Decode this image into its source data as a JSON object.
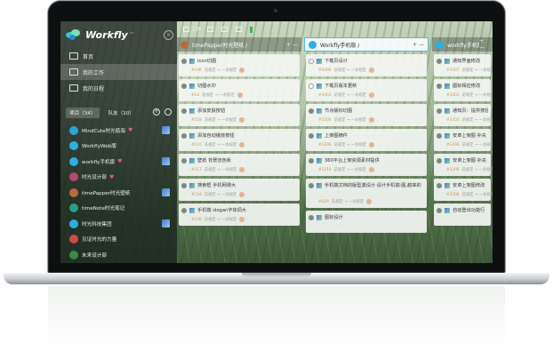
{
  "app": {
    "name": "Workfly",
    "tm": "™"
  },
  "sidebar": {
    "nav": [
      {
        "label": "首页",
        "icon": "home-icon"
      },
      {
        "label": "我的工作",
        "icon": "tasks-icon",
        "active": true
      },
      {
        "label": "我的日程",
        "icon": "calendar-icon"
      }
    ],
    "project_tab": "项目（34）",
    "team_tab": "队友（10）",
    "projects": [
      {
        "name": "MindCute时光瓶海",
        "color": "#26a6d8",
        "heart": "♥",
        "thumb": true
      },
      {
        "name": "WorkflyWeb版",
        "color": "#2ab0e6",
        "heart": "",
        "thumb": false
      },
      {
        "name": "workfly手机版",
        "color": "#2ab0e6",
        "heart": "♥",
        "thumb": true
      },
      {
        "name": "时光设计部",
        "color": "#b04b72",
        "heart": "♥",
        "thumb": false
      },
      {
        "name": "timePapper时光壁纸",
        "color": "#b86a3c",
        "heart": "",
        "thumb": true
      },
      {
        "name": "timeNote时光笔记",
        "color": "#2a9d82",
        "heart": "",
        "thumb": false
      },
      {
        "name": "时光科技集团",
        "color": "#2ab0e6",
        "heart": "",
        "thumb": true
      },
      {
        "name": "见证时光的力量",
        "color": "#d04a4a",
        "heart": "",
        "thumb": false
      },
      {
        "name": "未来设计部",
        "color": "#3a8a4a",
        "heart": "",
        "thumb": false
      }
    ]
  },
  "topbar": [
    {
      "label": "工作",
      "icon": "board-icon"
    },
    {
      "label": "",
      "icon": "list-icon"
    },
    {
      "label": "",
      "icon": "file-icon"
    },
    {
      "label": "",
      "icon": "chart-icon"
    }
  ],
  "columns": [
    {
      "title": "timePapper时光壁纸 /",
      "color": "#b86a3c",
      "highlight": false,
      "cards": [
        {
          "title": "icon切图",
          "id": "#146",
          "meta": "迭规定 → 一龙规定"
        },
        {
          "title": "切图水印",
          "id": "#14",
          "meta": "迭规定 → 一龙规定"
        },
        {
          "title": "添加皮肤按钮",
          "id": "#118",
          "meta": "迭规定 → 一龙规定"
        },
        {
          "title": "添加自动播放按钮",
          "id": "#116",
          "meta": "迭规定 → 一龙规定"
        },
        {
          "title": "壁纸 背景流色板",
          "id": "#117",
          "meta": "迭规定 → 一龙规定"
        },
        {
          "title": "搜索框 手机网课大",
          "id": "#134",
          "meta": "迭规定 → 一龙规定"
        },
        {
          "title": "手机端 slogan字体调大",
          "id": "#136",
          "meta": "迭规定 → 一龙规定"
        }
      ]
    },
    {
      "title": "Workfly手机版 /",
      "color": "#2ab0e6",
      "highlight": true,
      "cards": [
        {
          "title": "下载页设计",
          "id": "#3494",
          "meta": "迭规定 → 一龙规定",
          "open": true
        },
        {
          "title": "下载页版本更新",
          "id": "#3463",
          "meta": "迭规定 → 一龙规定",
          "open": true
        },
        {
          "title": "节点版标切图",
          "id": "#3506",
          "meta": "迭规定 → 一龙规定"
        },
        {
          "title": "上架图摘件",
          "id": "#3308",
          "meta": "迭规定 → 一龙规定"
        },
        {
          "title": "360平台上架资源素材提供",
          "id": "#3310",
          "meta": "迭规定 → 一龙规定"
        },
        {
          "title": "手机端文档的版型激设计·设计手机端·图,越来的",
          "id": "#429",
          "meta": "迭规定 → 一龙规定",
          "tall": true
        },
        {
          "title": "图标设计",
          "id": "",
          "meta": ""
        }
      ]
    },
    {
      "title": "workfly手机版 /",
      "color": "#2ab0e6",
      "highlight": false,
      "cards": [
        {
          "title": "通知界面修改",
          "id": "#3307",
          "meta": "迭规定 → 一龙规定"
        },
        {
          "title": "图标相应修改",
          "id": "#3303",
          "meta": "迭规定 → 一龙规定"
        },
        {
          "title": "通知页：提供按钮",
          "id": "#3303",
          "meta": "迭规定 → 一龙规定"
        },
        {
          "title": "安卓上架图 补充",
          "id": "#3308",
          "meta": "迭规定 → 一龙规定"
        },
        {
          "title": "安卓上架图 补充",
          "id": "#3308",
          "meta": "迭规定 → 一龙规定"
        },
        {
          "title": "安卓上架图修改",
          "id": "#3308",
          "meta": "迭规定 → 一龙规定"
        },
        {
          "title": "自动登出功能行",
          "id": "",
          "meta": ""
        }
      ]
    }
  ],
  "colors": {
    "accent": "#2ab0e6",
    "heart": "#ea5d67",
    "sidebar_bg": "#19231e"
  }
}
